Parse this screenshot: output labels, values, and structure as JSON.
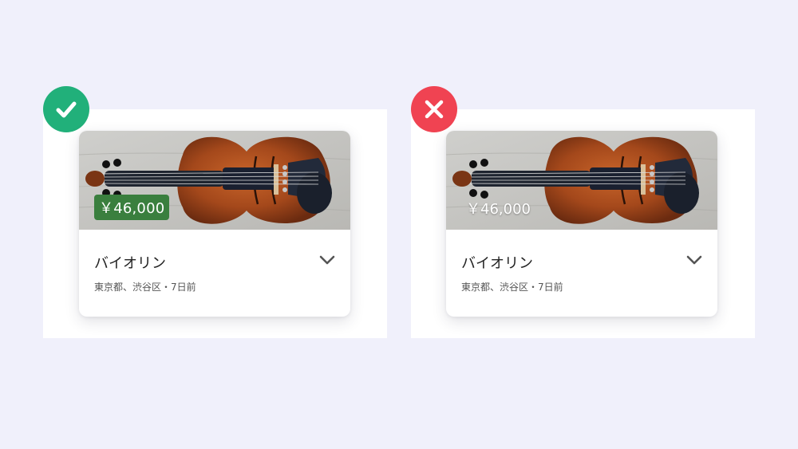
{
  "colors": {
    "background": "#f0f0fb",
    "good_badge": "#21b07a",
    "bad_badge": "#f04352",
    "price_tag_bg": "#3a7f3e"
  },
  "examples": [
    {
      "status": "correct",
      "status_icon": "check-icon",
      "card": {
        "price": "￥46,000",
        "title": "バイオリン",
        "meta": "東京都、渋谷区・7日前",
        "toggle_icon": "chevron-down-icon"
      }
    },
    {
      "status": "incorrect",
      "status_icon": "close-icon",
      "card": {
        "price": "￥46,000",
        "title": "バイオリン",
        "meta": "東京都、渋谷区・7日前",
        "toggle_icon": "chevron-down-icon"
      }
    }
  ]
}
